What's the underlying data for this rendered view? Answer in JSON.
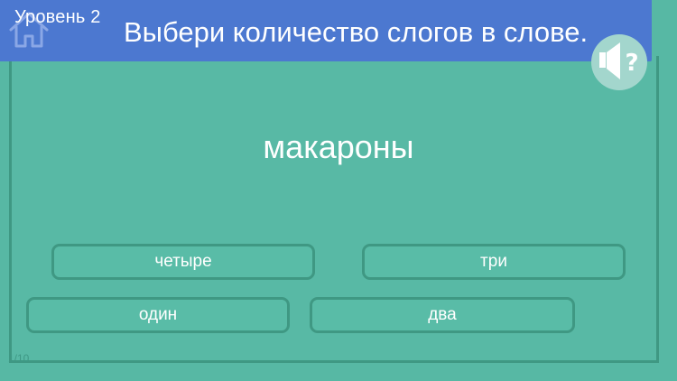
{
  "header": {
    "level_label": "Уровень 2",
    "instruction": "Выбери количество слогов в слове."
  },
  "icons": {
    "home": "home-icon",
    "sound_help": "speaker-question-icon"
  },
  "question": {
    "word": "макароны"
  },
  "answers": [
    {
      "label": "четыре"
    },
    {
      "label": "три"
    },
    {
      "label": "один"
    },
    {
      "label": "два"
    }
  ],
  "progress": {
    "text": "1/10"
  },
  "colors": {
    "background": "#57b8a4",
    "header": "#4c78d0",
    "border": "#3f9883",
    "sound_button": "#a3d6cd"
  }
}
